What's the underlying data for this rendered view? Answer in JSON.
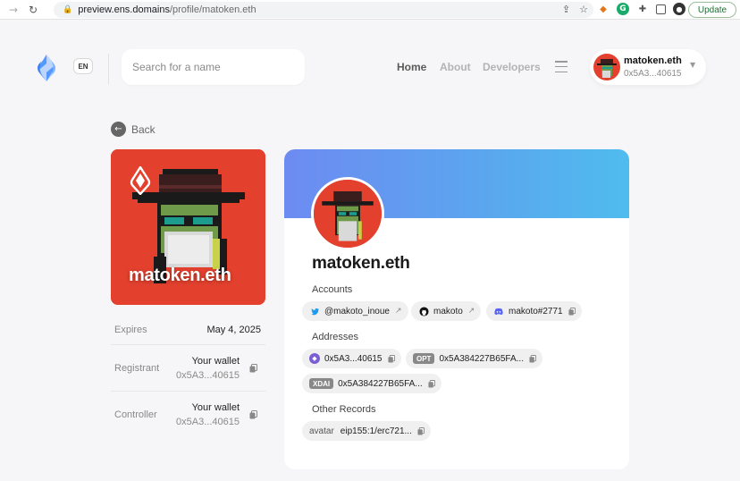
{
  "browser": {
    "url_host": "preview.ens.domains",
    "url_path": "/profile/matoken.eth",
    "update_label": "Update"
  },
  "header": {
    "lang": "EN",
    "search_placeholder": "Search for a name",
    "nav": {
      "home": "Home",
      "about": "About",
      "developers": "Developers"
    },
    "account": {
      "name": "matoken.eth",
      "address": "0x5A3...40615"
    }
  },
  "back_label": "Back",
  "nft_card": {
    "name": "matoken.eth"
  },
  "details": {
    "expires_label": "Expires",
    "expires_value": "May 4, 2025",
    "registrant_label": "Registrant",
    "registrant_wallet": "Your wallet",
    "registrant_address": "0x5A3...40615",
    "controller_label": "Controller",
    "controller_wallet": "Your wallet",
    "controller_address": "0x5A3...40615"
  },
  "profile": {
    "name": "matoken.eth",
    "accounts_title": "Accounts",
    "accounts": [
      {
        "service": "twitter",
        "value": "@makoto_inoue"
      },
      {
        "service": "github",
        "value": "makoto"
      },
      {
        "service": "discord",
        "value": "makoto#2771"
      }
    ],
    "addresses_title": "Addresses",
    "addresses": [
      {
        "coin": "ETH",
        "value": "0x5A3...40615"
      },
      {
        "coin": "OPT",
        "value": "0x5A384227B65FA..."
      },
      {
        "coin": "XDAI",
        "value": "0x5A384227B65FA..."
      }
    ],
    "other_title": "Other Records",
    "records": [
      {
        "key": "avatar",
        "value": "eip155:1/erc721..."
      }
    ]
  },
  "colors": {
    "banner_start": "#6d8bf2",
    "banner_end": "#4fbcee",
    "nft_background": "#e3412e",
    "eth_purple": "#7b5ed3"
  }
}
